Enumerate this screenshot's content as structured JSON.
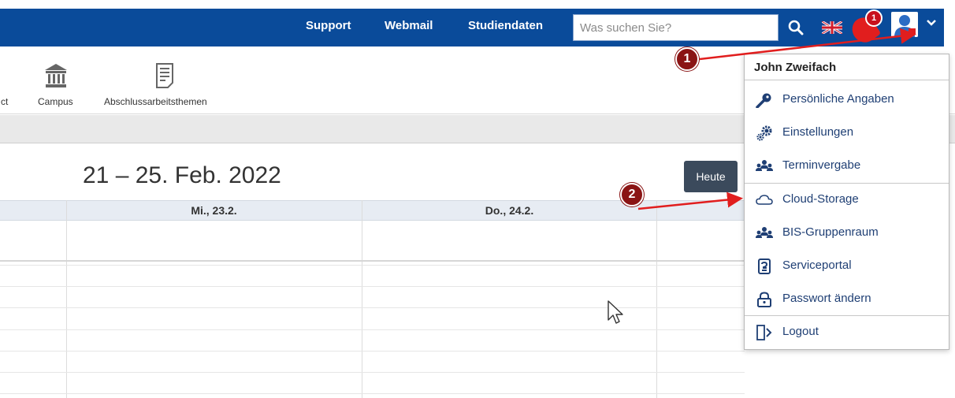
{
  "topbar": {
    "links": [
      "Support",
      "Webmail",
      "Studiendaten"
    ],
    "search_placeholder": "Was suchen Sie?",
    "notification_count": "1",
    "colors": {
      "bar": "#0a4b9a",
      "badge": "#c8101c"
    }
  },
  "toolbar": {
    "cut_label": "ct",
    "items": [
      {
        "label": "Campus",
        "icon": "bank-icon"
      },
      {
        "label": "Abschlussarbeitsthemen",
        "icon": "document-icon"
      }
    ]
  },
  "calendar": {
    "range_title": "21 – 25. Feb. 2022",
    "today_button": "Heute",
    "days": [
      "Mi., 23.2.",
      "Do., 24.2."
    ]
  },
  "user_menu": {
    "user_name": "John Zweifach",
    "items": [
      {
        "label": "Persönliche Angaben",
        "icon": "key-icon"
      },
      {
        "label": "Einstellungen",
        "icon": "gears-icon"
      },
      {
        "label": "Terminvergabe",
        "icon": "group-icon"
      },
      {
        "label": "Cloud-Storage",
        "icon": "cloud-icon"
      },
      {
        "label": "BIS-Gruppenraum",
        "icon": "group-icon"
      },
      {
        "label": "Serviceportal",
        "icon": "service-icon"
      },
      {
        "label": "Passwort ändern",
        "icon": "lock-icon"
      },
      {
        "label": "Logout",
        "icon": "logout-icon"
      }
    ]
  },
  "annotations": {
    "callout_1": "1",
    "callout_2": "2",
    "color": "#8a1414"
  }
}
